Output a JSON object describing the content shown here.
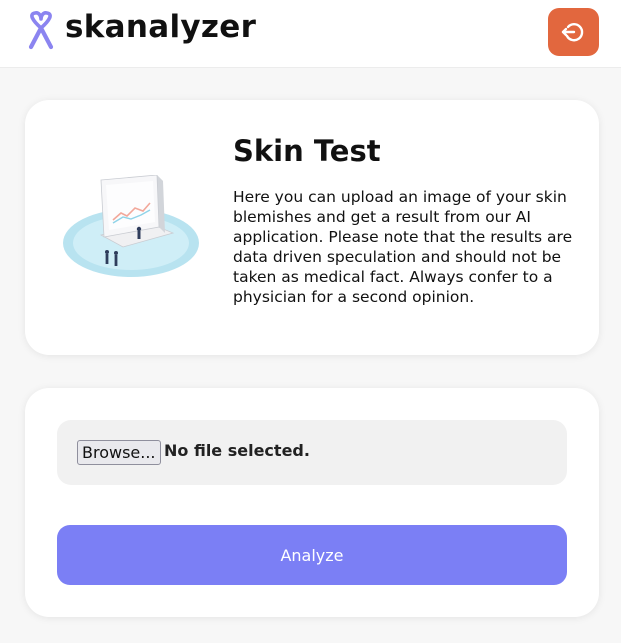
{
  "header": {
    "brand": "skanalyzer",
    "logo_icon": "ribbon-logo-icon",
    "logout_icon": "logout-icon",
    "accent_color": "#e2673e"
  },
  "info_card": {
    "illustration": "computer-chart-illustration",
    "title": "Skin Test",
    "description": "Here you can upload an image of your skin blemishes and get a result from our AI application. Please note that the results are data driven speculation and should not be taken as medical fact. Always confer to a physician for a second opinion."
  },
  "upload_card": {
    "browse_label": "Browse...",
    "file_status": "No file selected.",
    "analyze_label": "Analyze",
    "button_color": "#7b7ff5"
  }
}
